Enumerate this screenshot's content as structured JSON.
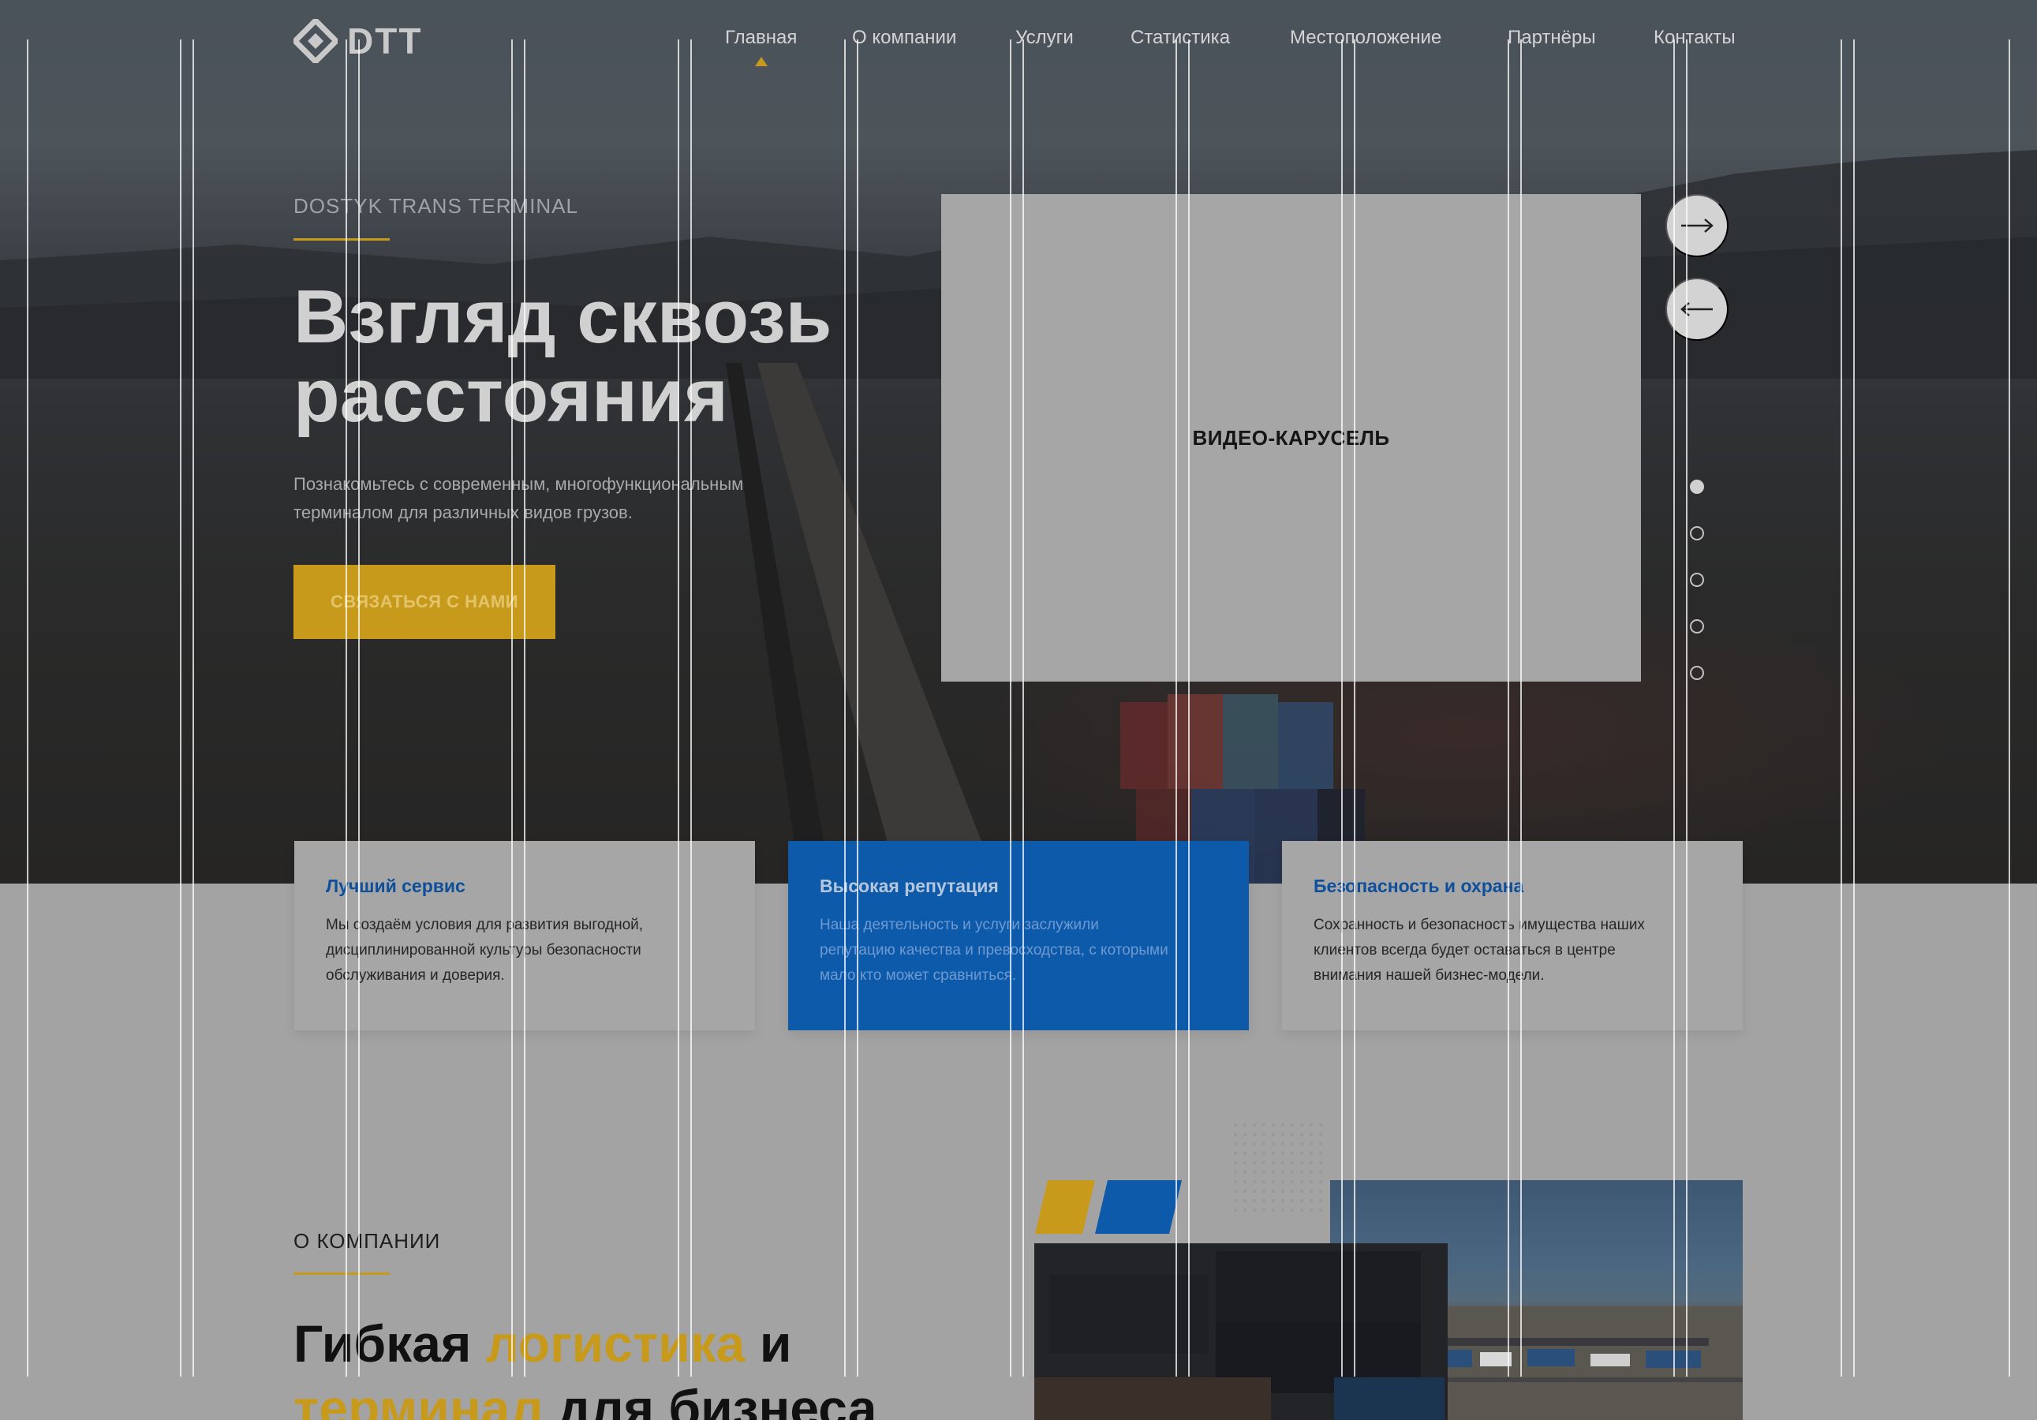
{
  "brand": {
    "name": "DTT",
    "logo_icon": "diamond-logo-icon"
  },
  "nav": {
    "items": [
      {
        "label": "Главная",
        "active": true
      },
      {
        "label": "О компании",
        "active": false
      },
      {
        "label": "Услуги",
        "active": false
      },
      {
        "label": "Статистика",
        "active": false
      },
      {
        "label": "Местоположение",
        "active": false
      },
      {
        "label": "Партнёры",
        "active": false
      },
      {
        "label": "Контакты",
        "active": false
      }
    ]
  },
  "hero": {
    "kicker": "DOSTYK TRANS TERMINAL",
    "title_line1": "Взгляд сквозь",
    "title_line2": "расстояния",
    "subtitle_line1": "Познакомьтесь с современным, многофункциональным",
    "subtitle_line2": "терминалом для различных видов грузов.",
    "cta_label": "СВЯЗАТЬСЯ С НАМИ"
  },
  "carousel": {
    "label": "ВИДЕО-КАРУСЕЛЬ",
    "next_icon": "arrow-right-icon",
    "prev_icon": "arrow-left-icon",
    "slide_count": 5,
    "active_slide": 1
  },
  "features": [
    {
      "title": "Лучший сервис",
      "lines": [
        "Мы создаём условия для развития выгодной,",
        "дисциплинированной культуры безопасности",
        "обслуживания и доверия."
      ]
    },
    {
      "title": "Высокая репутация",
      "lines": [
        "Наша деятельность и услуги заслужили",
        "репутацию качества и превосходства, с которыми",
        "мало кто может сравниться."
      ]
    },
    {
      "title": "Безопасность и охрана",
      "lines": [
        "Сохранность и безопасность имущества наших",
        "клиентов всегда будет оставаться в центре",
        "внимания нашей бизнес-модели."
      ]
    }
  ],
  "about": {
    "kicker": "О КОМПАНИИ",
    "title_part1": "Гибкая ",
    "title_highlight1": "логистика",
    "title_part2": " и",
    "title_highlight2": "терминал",
    "title_part3": " для бизнеса"
  },
  "colors": {
    "accent_yellow": "#c79a1c",
    "accent_blue": "#0d5aab",
    "title_blue": "#0d4f9a"
  }
}
